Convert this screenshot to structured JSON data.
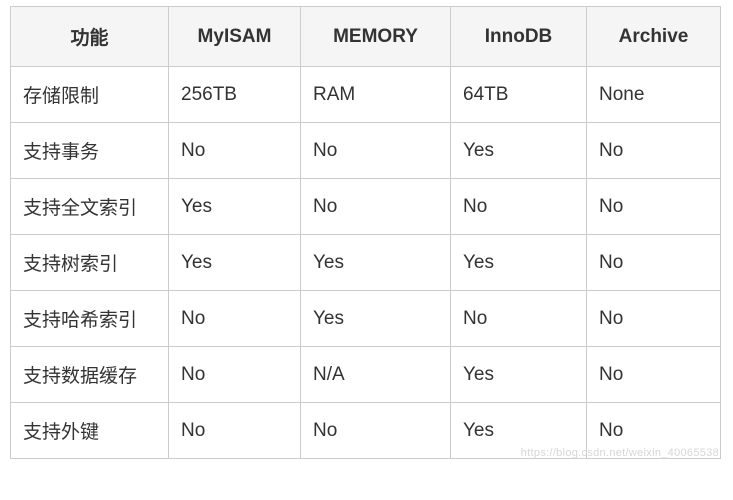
{
  "chart_data": {
    "type": "table",
    "headers": [
      "功能",
      "MyISAM",
      "MEMORY",
      "InnoDB",
      "Archive"
    ],
    "rows": [
      {
        "label": "存储限制",
        "cells": [
          "256TB",
          "RAM",
          "64TB",
          "None"
        ]
      },
      {
        "label": "支持事务",
        "cells": [
          "No",
          "No",
          "Yes",
          "No"
        ]
      },
      {
        "label": "支持全文索引",
        "cells": [
          "Yes",
          "No",
          "No",
          "No"
        ]
      },
      {
        "label": "支持树索引",
        "cells": [
          "Yes",
          "Yes",
          "Yes",
          "No"
        ]
      },
      {
        "label": "支持哈希索引",
        "cells": [
          "No",
          "Yes",
          "No",
          "No"
        ]
      },
      {
        "label": "支持数据缓存",
        "cells": [
          "No",
          "N/A",
          "Yes",
          "No"
        ]
      },
      {
        "label": "支持外键",
        "cells": [
          "No",
          "No",
          "Yes",
          "No"
        ]
      }
    ]
  },
  "watermark": "https://blog.csdn.net/weixin_40065538"
}
